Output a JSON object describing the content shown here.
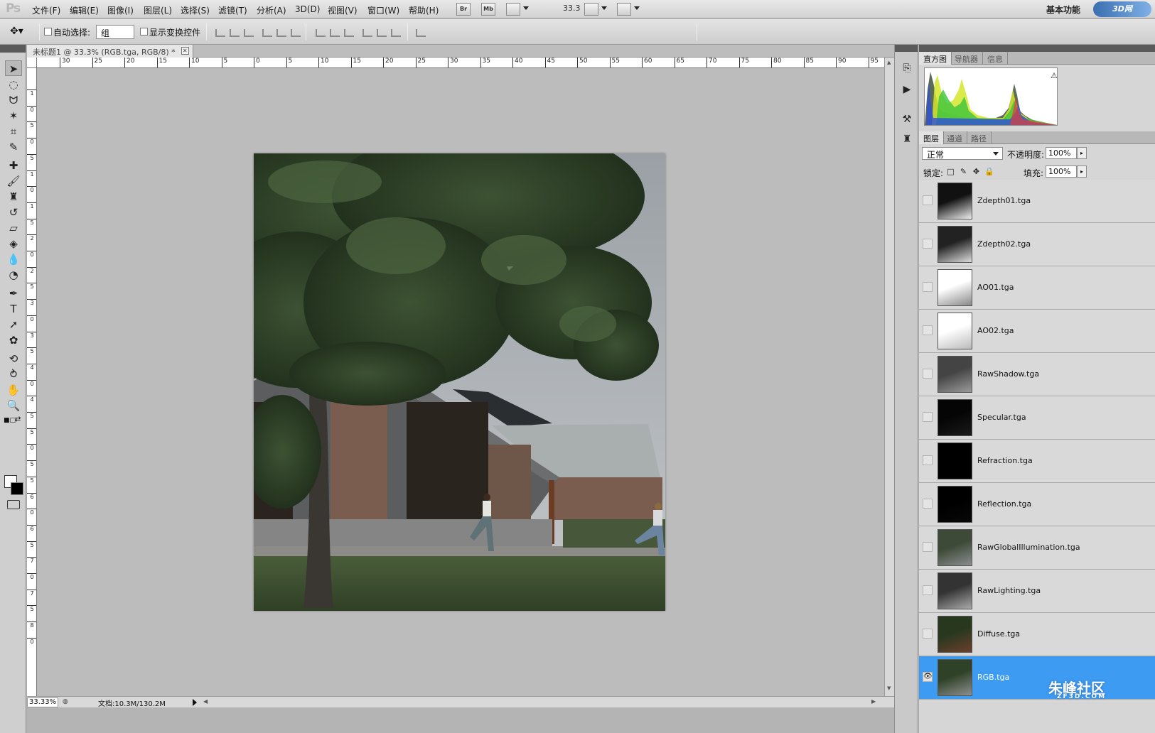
{
  "app": {
    "logo": "Ps",
    "workspace": "基本功能",
    "site_logo": "3D网"
  },
  "menu": [
    "文件(F)",
    "编辑(E)",
    "图像(I)",
    "图层(L)",
    "选择(S)",
    "滤镜(T)",
    "分析(A)",
    "3D(D)",
    "视图(V)",
    "窗口(W)",
    "帮助(H)"
  ],
  "menu_buttons": {
    "bridge": "Br",
    "mini_bridge": "Mb"
  },
  "zoom_field": "33.3",
  "options": {
    "auto_select_label": "自动选择:",
    "auto_select_value": "组",
    "show_transform_label": "显示变换控件"
  },
  "document": {
    "tab_title": "未标题1 @ 33.3% (RGB.tga, RGB/8) *",
    "ruler_h": [
      "30",
      "25",
      "20",
      "15",
      "10",
      "5",
      "0",
      "5",
      "10",
      "15",
      "20",
      "25",
      "30",
      "35",
      "40",
      "45",
      "50",
      "55",
      "60",
      "65",
      "70",
      "75",
      "80",
      "85",
      "90",
      "95"
    ],
    "ruler_v": [
      "1",
      "0",
      "5",
      "0",
      "5",
      "1",
      "0",
      "1",
      "5",
      "2",
      "0",
      "2",
      "5",
      "3",
      "0",
      "3",
      "5",
      "4",
      "0",
      "4",
      "5",
      "5",
      "0",
      "5",
      "5",
      "6",
      "0",
      "6",
      "5",
      "7",
      "0",
      "7",
      "5",
      "8",
      "0"
    ],
    "status_zoom": "33.33%",
    "status_doc": "文档:10.3M/130.2M"
  },
  "panels": {
    "top_tabs": [
      "直方图",
      "导航器",
      "信息"
    ],
    "layer_tabs": [
      "图层",
      "通道",
      "路径"
    ],
    "blend_mode": "正常",
    "opacity_label": "不透明度:",
    "opacity_value": "100%",
    "lock_label": "锁定:",
    "fill_label": "填充:",
    "fill_value": "100%"
  },
  "layers": [
    {
      "name": "Zdepth01.tga",
      "visible": false,
      "selected": false
    },
    {
      "name": "Zdepth02.tga",
      "visible": false,
      "selected": false
    },
    {
      "name": "AO01.tga",
      "visible": false,
      "selected": false
    },
    {
      "name": "AO02.tga",
      "visible": false,
      "selected": false
    },
    {
      "name": "RawShadow.tga",
      "visible": false,
      "selected": false
    },
    {
      "name": "Specular.tga",
      "visible": false,
      "selected": false
    },
    {
      "name": "Refraction.tga",
      "visible": false,
      "selected": false
    },
    {
      "name": "Reflection.tga",
      "visible": false,
      "selected": false
    },
    {
      "name": "RawGlobalIllumination.tga",
      "visible": false,
      "selected": false
    },
    {
      "name": "RawLighting.tga",
      "visible": false,
      "selected": false
    },
    {
      "name": "Diffuse.tga",
      "visible": false,
      "selected": false
    },
    {
      "name": "RGB.tga",
      "visible": true,
      "selected": true
    }
  ],
  "watermark": {
    "main": "朱峰社区",
    "sub": "ZF3D.COM"
  },
  "colors": {
    "selection": "#3d9bf2",
    "canvas_bg": "#bcbcbc",
    "panel_bg": "#d6d6d6"
  }
}
